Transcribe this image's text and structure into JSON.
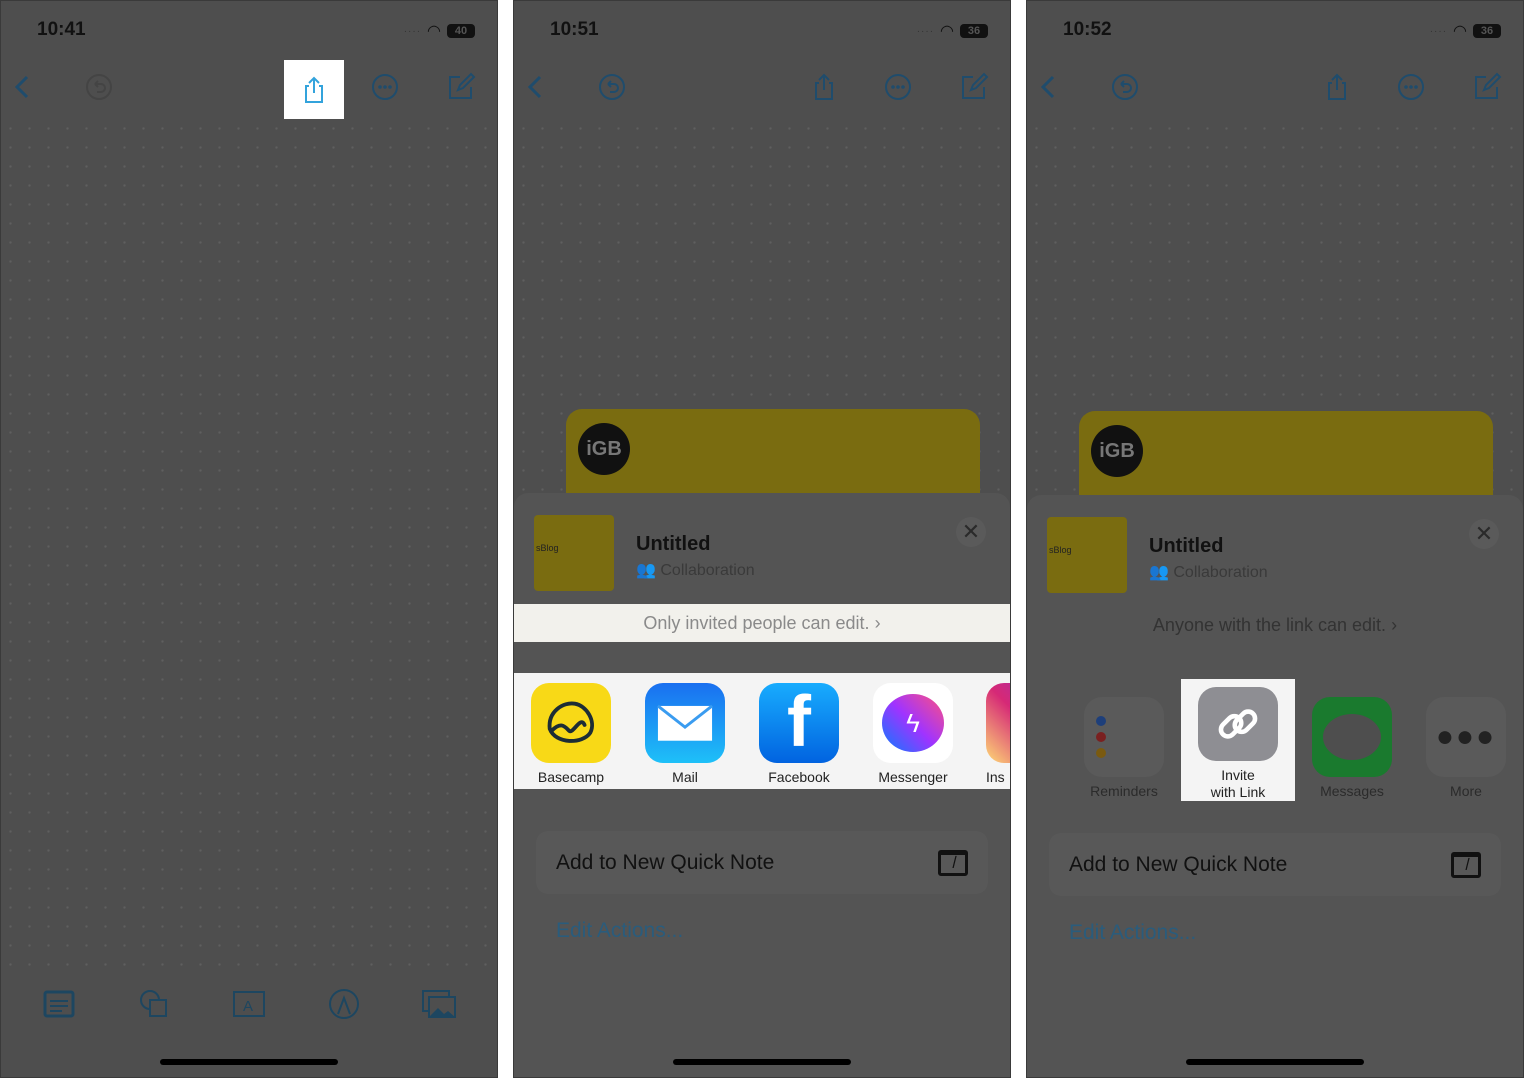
{
  "panels": [
    {
      "time": "10:41",
      "battery": "40"
    },
    {
      "time": "10:51",
      "battery": "36"
    },
    {
      "time": "10:52",
      "battery": "36"
    }
  ],
  "toolbar_icons": [
    "back-chevron-icon",
    "undo-icon",
    "share-icon",
    "more-circle-icon",
    "compose-icon"
  ],
  "bottom_icons": [
    "note-list-icon",
    "shapes-icon",
    "text-box-icon",
    "pen-icon",
    "media-icon"
  ],
  "banner": {
    "logo": "iGB"
  },
  "share": {
    "title": "Untitled",
    "subtitle": "Collaboration",
    "thumb_text": "sBlog",
    "permission_p2": "Only invited people can edit.",
    "permission_p3": "Anyone with the link can edit.",
    "chevron": "›",
    "apps_p2": [
      {
        "label": "Basecamp",
        "color": "#f8d917"
      },
      {
        "label": "Mail",
        "color": "#1a8cf0"
      },
      {
        "label": "Facebook",
        "color": "#1877f2"
      },
      {
        "label": "Messenger",
        "color": "#ffffff"
      },
      {
        "label": "Ins",
        "color": "#d62f7e"
      }
    ],
    "apps_p3": [
      {
        "label": "Reminders",
        "color": "#5a5a5a"
      },
      {
        "label": "Invite\nwith Link",
        "color": "#8e8e93"
      },
      {
        "label": "Messages",
        "color": "#1a7a2e"
      },
      {
        "label": "More",
        "color": "#5a5a5a"
      }
    ],
    "quick_note": "Add to New Quick Note",
    "edit_actions": "Edit Actions..."
  },
  "colors": {
    "highlight": "#ffffff",
    "accent": "#33a3dc",
    "dim_overlay": "#4e4e4e"
  }
}
